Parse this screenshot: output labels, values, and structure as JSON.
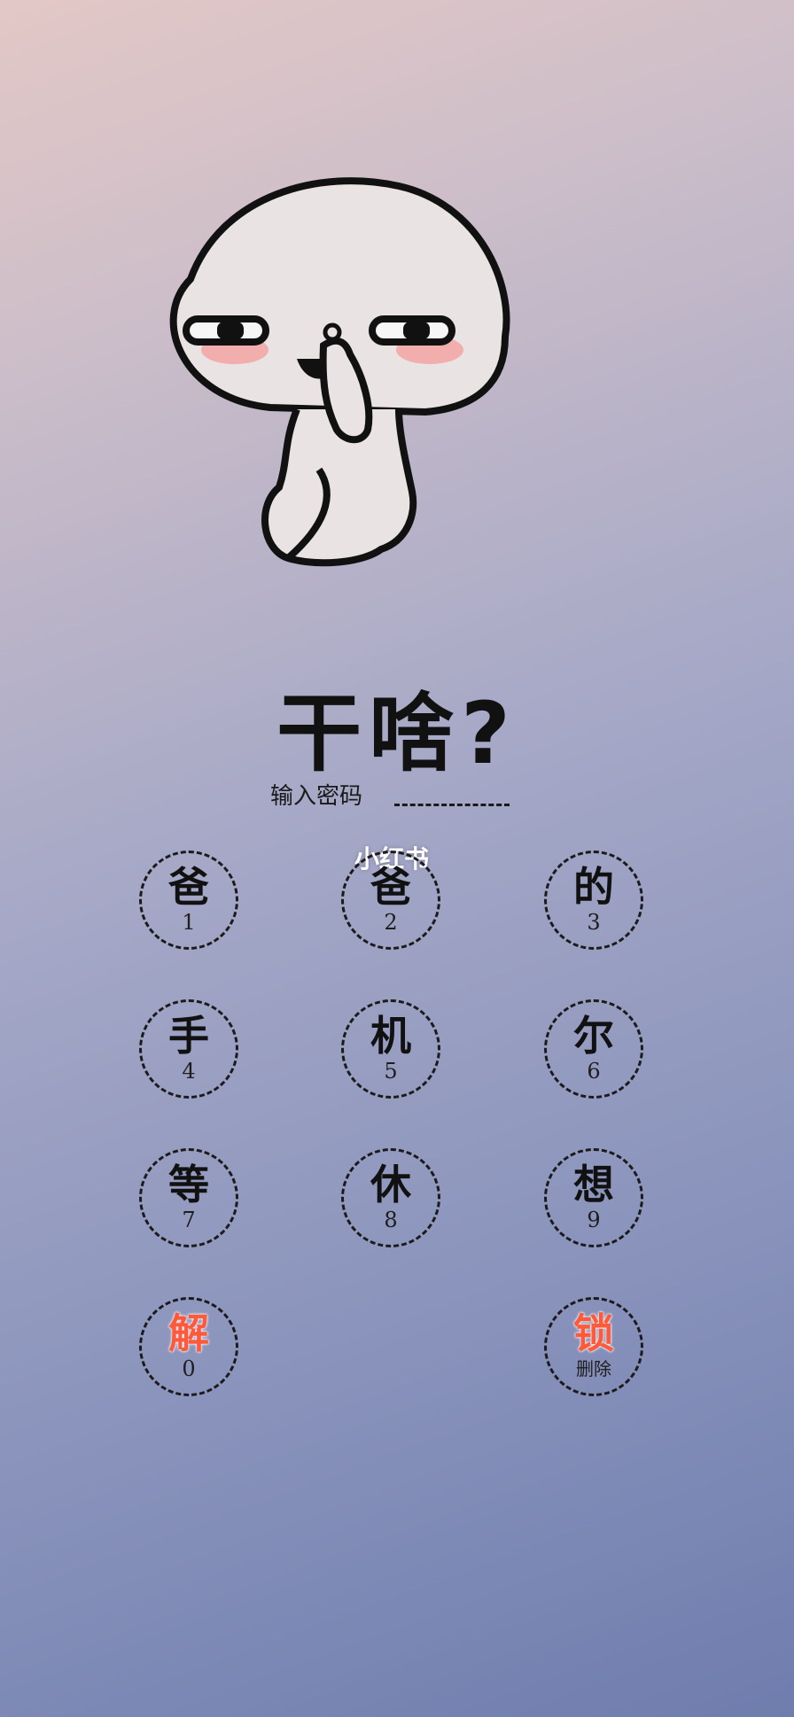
{
  "title": "干啥?",
  "password_prompt": "输入密码",
  "watermark": "小红书",
  "keys": [
    {
      "glyph": "爸",
      "label": "1"
    },
    {
      "glyph": "爸",
      "label": "2"
    },
    {
      "glyph": "的",
      "label": "3"
    },
    {
      "glyph": "手",
      "label": "4"
    },
    {
      "glyph": "机",
      "label": "5"
    },
    {
      "glyph": "尔",
      "label": "6"
    },
    {
      "glyph": "等",
      "label": "7"
    },
    {
      "glyph": "休",
      "label": "8"
    },
    {
      "glyph": "想",
      "label": "9"
    },
    {
      "glyph": "解",
      "label": "0"
    },
    {
      "glyph": "锁",
      "label": "删除"
    }
  ],
  "colors": {
    "accent": "#ff5a3c",
    "ink": "#111111"
  }
}
